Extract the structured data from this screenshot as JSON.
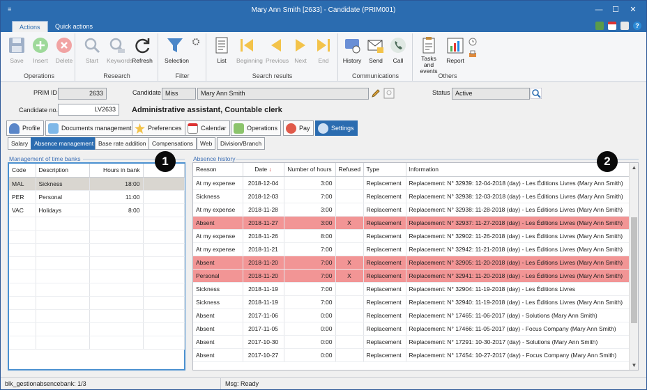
{
  "window": {
    "title": "Mary Ann Smith [2633] - Candidate (PRIM001)",
    "minimize": "—",
    "maximize": "☐",
    "close": "✕",
    "sysmenu": "≡"
  },
  "ribbon_tabs": [
    "Actions",
    "Quick actions"
  ],
  "ribbon": {
    "operations": {
      "label": "Operations",
      "save": "Save",
      "insert": "Insert",
      "delete": "Delete"
    },
    "research": {
      "label": "Research",
      "start": "Start",
      "keywords": "Keywords",
      "refresh": "Refresh"
    },
    "filter": {
      "label": "Filter",
      "selection": "Selection"
    },
    "search_results": {
      "label": "Search results",
      "list": "List",
      "beginning": "Beginning",
      "previous": "Previous",
      "next": "Next",
      "end": "End"
    },
    "communications": {
      "label": "Communications",
      "history": "History",
      "send": "Send",
      "call": "Call"
    },
    "others": {
      "label": "Others",
      "tasks": "Tasks and events",
      "report": "Report"
    }
  },
  "form": {
    "prim_id_label": "PRIM ID",
    "prim_id": "2633",
    "candidate_label": "Candidate",
    "title": "Miss",
    "name": "Mary Ann Smith",
    "status_label": "Status",
    "status": "Active",
    "candidate_no_label": "Candidate no.",
    "candidate_no": "LV2633",
    "description": "Administrative assistant, Countable clerk"
  },
  "main_tabs": [
    "Profile",
    "Documents management",
    "Preferences",
    "Calendar",
    "Operations",
    "Pay",
    "Settings"
  ],
  "sub_tabs": [
    "Salary",
    "Absence management",
    "Base rate addition",
    "Compensations",
    "Web",
    "Division/Branch"
  ],
  "left_panel": {
    "title": "Management of time banks",
    "columns": [
      "Code",
      "Description",
      "Hours in bank"
    ],
    "rows": [
      [
        "MAL",
        "Sickness",
        "18:00"
      ],
      [
        "PER",
        "Personal",
        "11:00"
      ],
      [
        "VAC",
        "Holidays",
        "8:00"
      ]
    ]
  },
  "right_panel": {
    "title": "Absence history",
    "columns": [
      "Reason",
      "Date",
      "Number of hours",
      "Refused",
      "Type",
      "Information"
    ],
    "rows": [
      [
        "At my expense",
        "2018-12-04",
        "3:00",
        "",
        "Replacement",
        "Replacement: N° 32939: 12-04-2018 (day) - Les Éditions Livres (Mary Ann Smith)"
      ],
      [
        "Sickness",
        "2018-12-03",
        "7:00",
        "",
        "Replacement",
        "Replacement: N° 32938: 12-03-2018 (day) - Les Éditions Livres (Mary Ann Smith)"
      ],
      [
        "At my expense",
        "2018-11-28",
        "3:00",
        "",
        "Replacement",
        "Replacement: N° 32938: 11-28-2018 (day) - Les Éditions Livres (Mary Ann Smith)"
      ],
      [
        "Absent",
        "2018-11-27",
        "3:00",
        "X",
        "Replacement",
        "Replacement: N° 32937: 11-27-2018 (day) - Les Éditions Livres (Mary Ann Smith)"
      ],
      [
        "At my expense",
        "2018-11-26",
        "8:00",
        "",
        "Replacement",
        "Replacement: N° 32902: 11-26-2018 (day) - Les Éditions Livres (Mary Ann Smith)"
      ],
      [
        "At my expense",
        "2018-11-21",
        "7:00",
        "",
        "Replacement",
        "Replacement: N° 32942: 11-21-2018 (day) - Les Éditions Livres (Mary Ann Smith)"
      ],
      [
        "Absent",
        "2018-11-20",
        "7:00",
        "X",
        "Replacement",
        "Replacement: N° 32905: 11-20-2018 (day) - Les Éditions Livres (Mary Ann Smith)"
      ],
      [
        "Personal",
        "2018-11-20",
        "7:00",
        "X",
        "Replacement",
        "Replacement: N° 32941: 11-20-2018 (day) - Les Éditions Livres (Mary Ann Smith)"
      ],
      [
        "Sickness",
        "2018-11-19",
        "7:00",
        "",
        "Replacement",
        "Replacement: N° 32904: 11-19-2018 (day) - Les Éditions Livres"
      ],
      [
        "Sickness",
        "2018-11-19",
        "7:00",
        "",
        "Replacement",
        "Replacement: N° 32940: 11-19-2018 (day) - Les Éditions Livres (Mary Ann Smith)"
      ],
      [
        "Absent",
        "2017-11-06",
        "0:00",
        "",
        "Replacement",
        "Replacement: N° 17465: 11-06-2017 (day) - Solutions (Mary Ann Smith)"
      ],
      [
        "Absent",
        "2017-11-05",
        "0:00",
        "",
        "Replacement",
        "Replacement: N° 17466: 11-05-2017 (day) - Focus Company (Mary Ann Smith)"
      ],
      [
        "Absent",
        "2017-10-30",
        "0:00",
        "",
        "Replacement",
        "Replacement: N° 17291: 10-30-2017 (day) - Solutions (Mary Ann Smith)"
      ],
      [
        "Absent",
        "2017-10-27",
        "0:00",
        "",
        "Replacement",
        "Replacement: N° 17454: 10-27-2017 (day) - Focus Company (Mary Ann Smith)"
      ]
    ]
  },
  "badges": [
    "1",
    "2"
  ],
  "statusbar": {
    "left": "blk_gestionabsencebank: 1/3",
    "right": "Msg: Ready"
  },
  "colors": {
    "accent": "#2b6cb0",
    "refused_row": "#f29595",
    "selected_row": "#d9d6d0"
  }
}
